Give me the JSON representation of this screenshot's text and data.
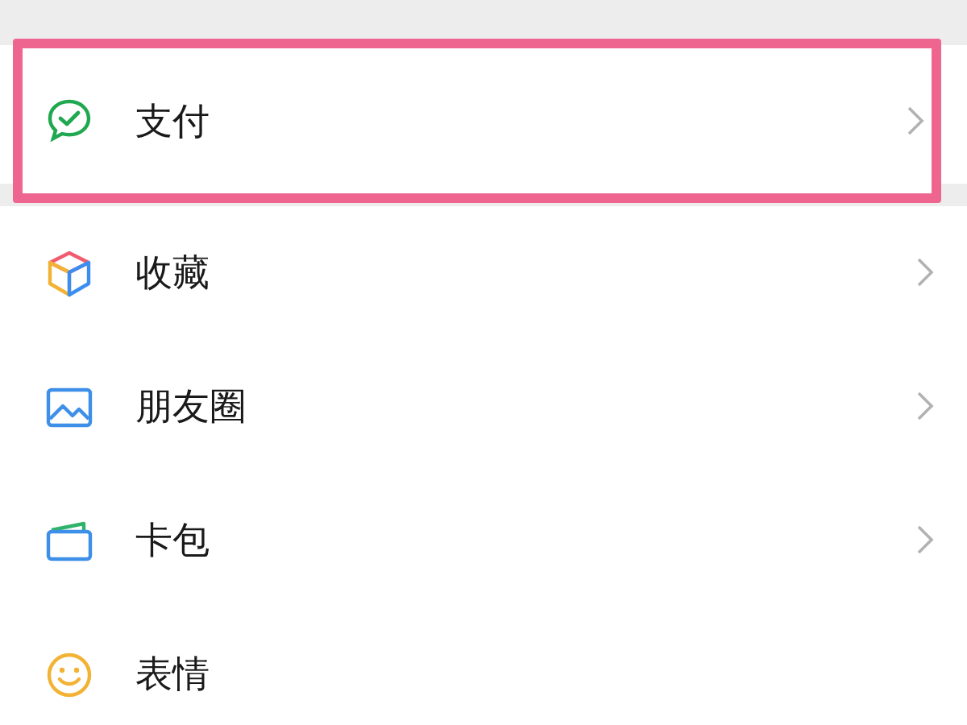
{
  "menu_sections": [
    {
      "items": [
        {
          "label": "支付",
          "kind": "pay",
          "chevron": true,
          "highlighted": true
        }
      ]
    },
    {
      "items": [
        {
          "label": "收藏",
          "kind": "favorites",
          "chevron": true,
          "highlighted": false
        },
        {
          "label": "朋友圈",
          "kind": "moments",
          "chevron": true,
          "highlighted": false
        },
        {
          "label": "卡包",
          "kind": "cards",
          "chevron": true,
          "highlighted": false
        },
        {
          "label": "表情",
          "kind": "stickers",
          "chevron": false,
          "highlighted": false
        }
      ]
    }
  ]
}
